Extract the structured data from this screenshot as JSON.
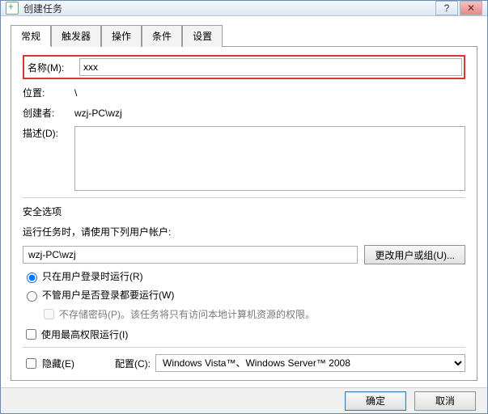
{
  "window": {
    "title": "创建任务"
  },
  "tabs": {
    "items": [
      {
        "label": "常规"
      },
      {
        "label": "触发器"
      },
      {
        "label": "操作"
      },
      {
        "label": "条件"
      },
      {
        "label": "设置"
      }
    ]
  },
  "form": {
    "name_label": "名称(M):",
    "name_value": "xxx",
    "location_label": "位置:",
    "location_value": "\\",
    "creator_label": "创建者:",
    "creator_value": "wzj-PC\\wzj",
    "desc_label": "描述(D):",
    "desc_value": ""
  },
  "security": {
    "header": "安全选项",
    "runas_text": "运行任务时，请使用下列用户帐户:",
    "user": "wzj-PC\\wzj",
    "change_user_btn": "更改用户或组(U)...",
    "radio1": "只在用户登录时运行(R)",
    "radio2": "不管用户是否登录都要运行(W)",
    "nostore": "不存储密码(P)。该任务将只有访问本地计算机资源的权限。",
    "highest": "使用最高权限运行(I)"
  },
  "bottom": {
    "hidden": "隐藏(E)",
    "configure_label": "配置(C):",
    "configure_value": "Windows Vista™、Windows Server™ 2008"
  },
  "footer": {
    "ok": "确定",
    "cancel": "取消"
  }
}
